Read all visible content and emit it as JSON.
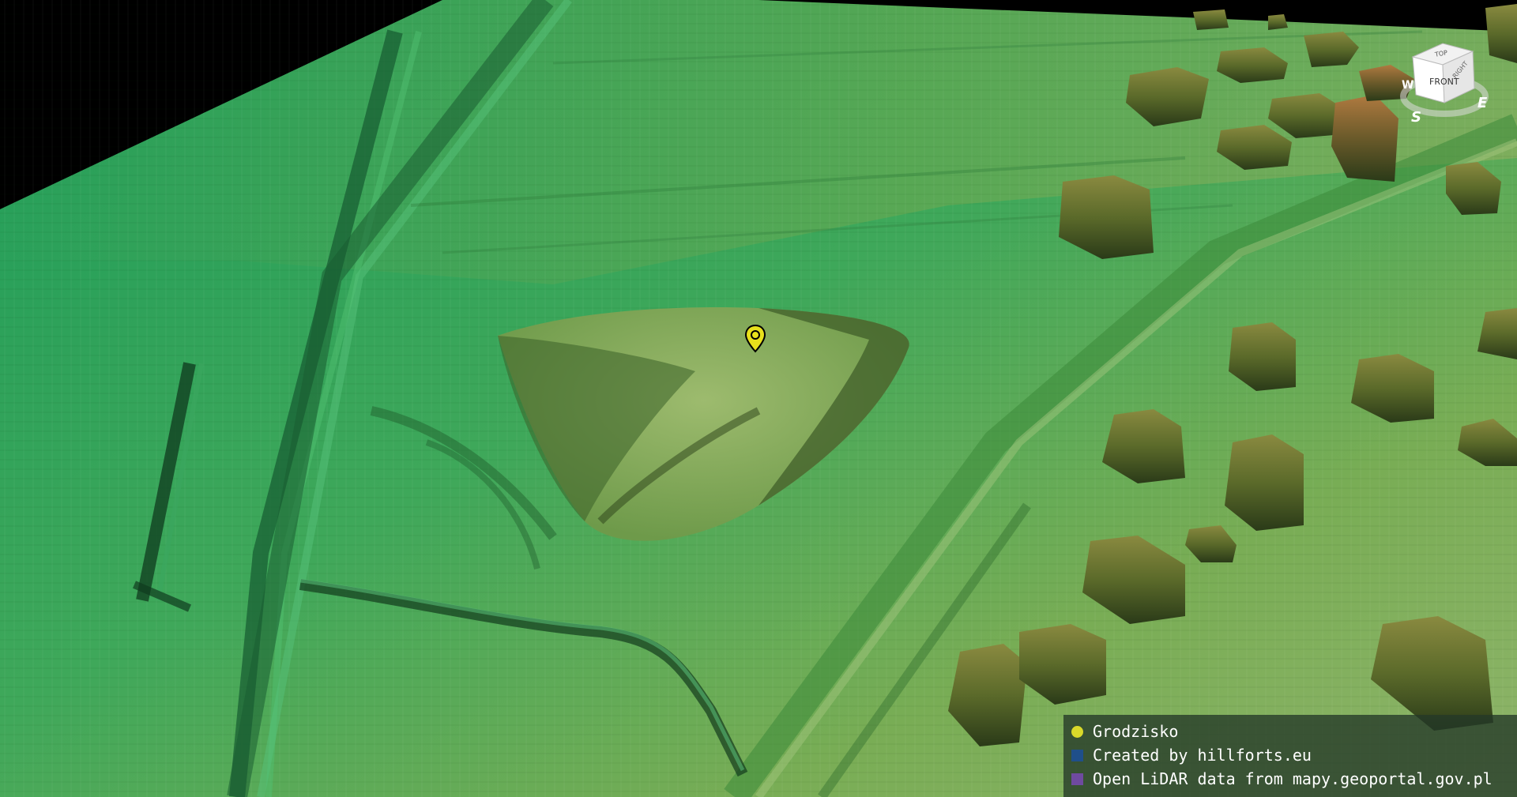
{
  "legend": {
    "items": [
      {
        "label": "Grodzisko",
        "color": "#d9d92a",
        "shape": "circle"
      },
      {
        "label": "Created by hillforts.eu",
        "color": "#1f4f8a",
        "shape": "square"
      },
      {
        "label": "Open LiDAR data from mapy.geoportal.gov.pl",
        "color": "#6f4aa0",
        "shape": "square"
      }
    ]
  },
  "navigation_cube": {
    "faces": {
      "front": "FRONT",
      "top": "TOP",
      "right": "RIGHT"
    },
    "compass": {
      "west": "W",
      "south": "S",
      "east": "E"
    }
  },
  "marker": {
    "icon": "map-pin-icon",
    "color": "#e8e01c"
  },
  "terrain": {
    "colors": {
      "low": "#1fa060",
      "mid": "#6aa84a",
      "high": "#a88a3a",
      "shadow": "#1a3a1a",
      "sky": "#000000"
    }
  }
}
